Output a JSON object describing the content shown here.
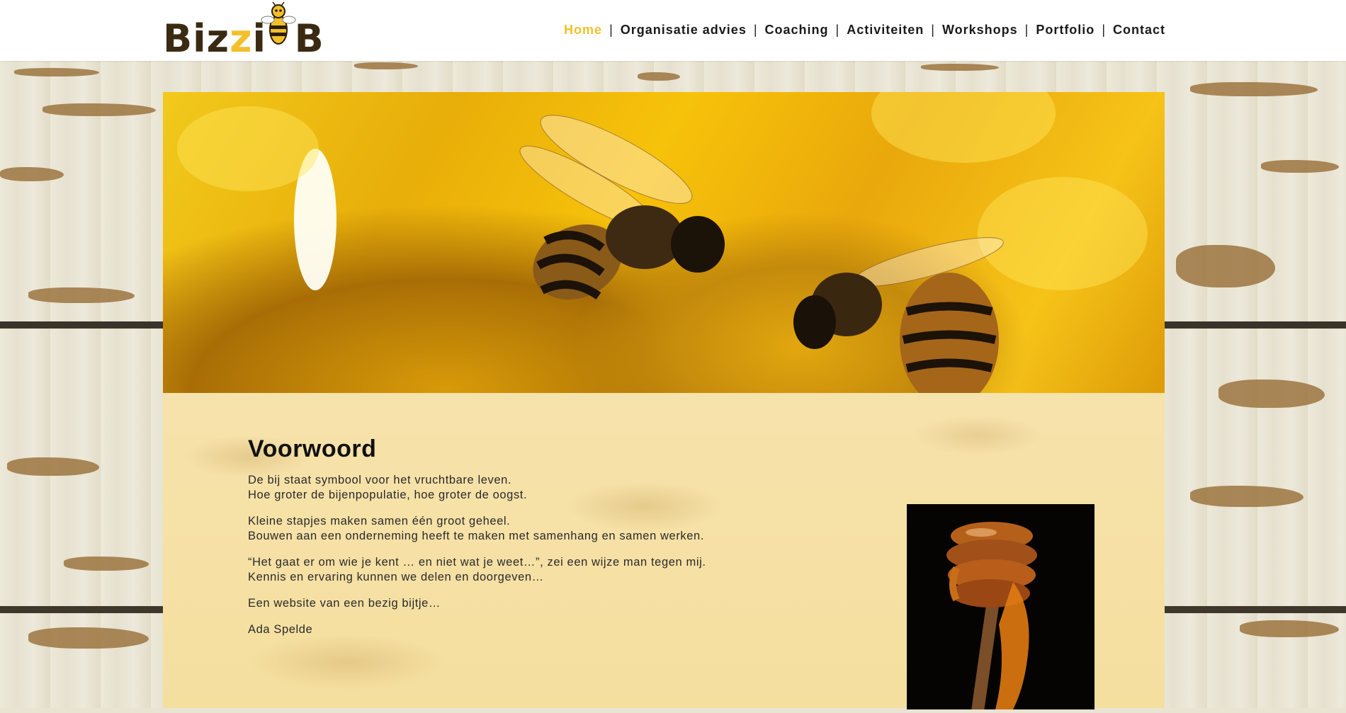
{
  "site": {
    "logo_text": "Bizz▪B",
    "logo_alt": "BizzyB bee logo"
  },
  "nav": {
    "items": [
      {
        "label": "Home",
        "active": true
      },
      {
        "label": "Organisatie advies",
        "active": false
      },
      {
        "label": "Coaching",
        "active": false
      },
      {
        "label": "Activiteiten",
        "active": false
      },
      {
        "label": "Workshops",
        "active": false
      },
      {
        "label": "Portfolio",
        "active": false
      },
      {
        "label": "Contact",
        "active": false
      }
    ],
    "separator": "|"
  },
  "article": {
    "title": "Voorwoord",
    "paragraphs": [
      {
        "line1": "De bij staat symbool voor het vruchtbare leven.",
        "line2": "Hoe groter de bijenpopulatie, hoe groter de oogst."
      },
      {
        "line1": "Kleine stapjes maken samen één groot geheel.",
        "line2": "Bouwen aan een onderneming heeft te maken met samenhang en samen werken."
      },
      {
        "line1": "“Het gaat er om wie je kent … en niet wat je weet…”, zei een wijze man tegen mij.",
        "line2": "Kennis en ervaring kunnen we delen en doorgeven…"
      },
      {
        "line1": "Een website van een bezig bijtje…",
        "line2": ""
      },
      {
        "line1": "Ada Spelde",
        "line2": ""
      }
    ]
  },
  "colors": {
    "nav_active": "#f2c02a",
    "content_bg": "#f5df9f"
  }
}
